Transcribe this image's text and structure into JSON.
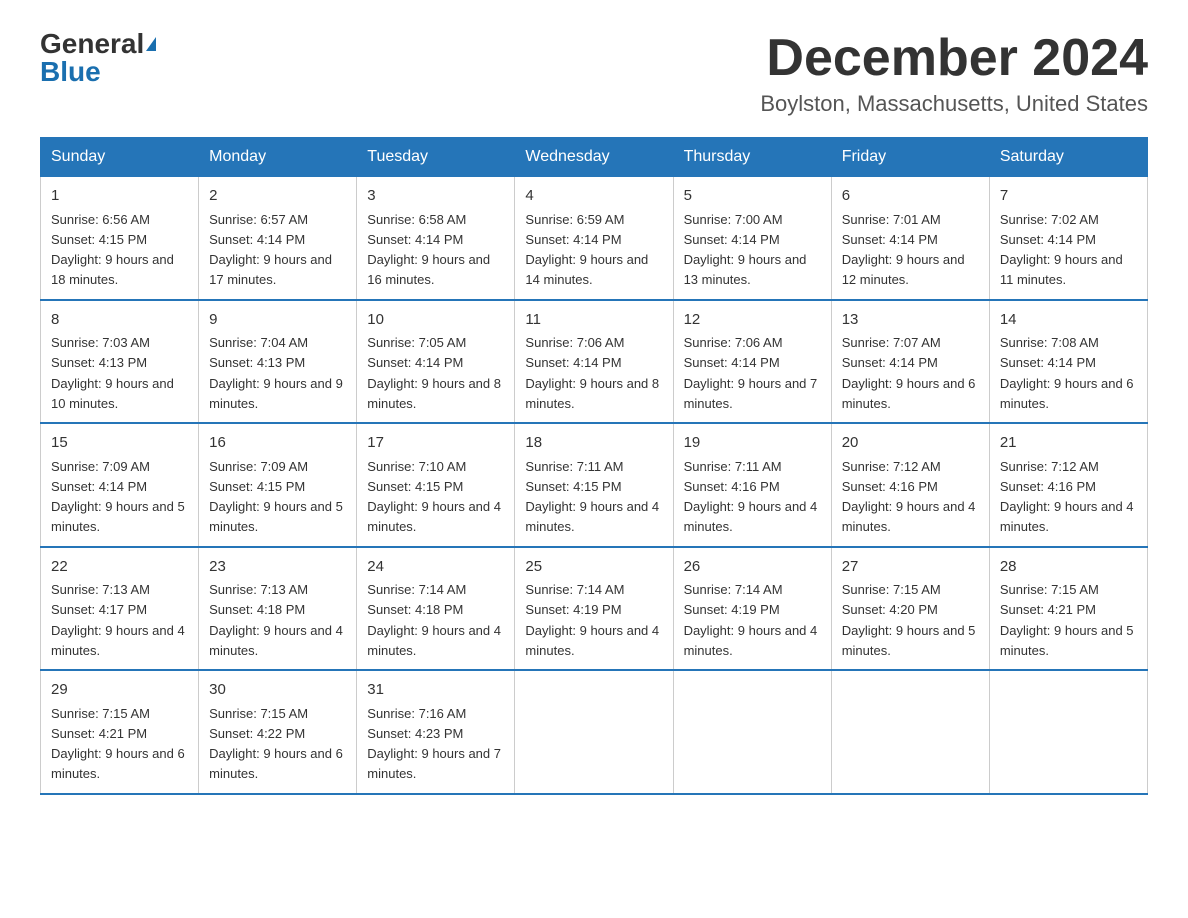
{
  "header": {
    "logo_general": "General",
    "logo_blue": "Blue",
    "title": "December 2024",
    "subtitle": "Boylston, Massachusetts, United States"
  },
  "weekdays": [
    "Sunday",
    "Monday",
    "Tuesday",
    "Wednesday",
    "Thursday",
    "Friday",
    "Saturday"
  ],
  "weeks": [
    [
      {
        "day": "1",
        "sunrise": "6:56 AM",
        "sunset": "4:15 PM",
        "daylight": "9 hours and 18 minutes."
      },
      {
        "day": "2",
        "sunrise": "6:57 AM",
        "sunset": "4:14 PM",
        "daylight": "9 hours and 17 minutes."
      },
      {
        "day": "3",
        "sunrise": "6:58 AM",
        "sunset": "4:14 PM",
        "daylight": "9 hours and 16 minutes."
      },
      {
        "day": "4",
        "sunrise": "6:59 AM",
        "sunset": "4:14 PM",
        "daylight": "9 hours and 14 minutes."
      },
      {
        "day": "5",
        "sunrise": "7:00 AM",
        "sunset": "4:14 PM",
        "daylight": "9 hours and 13 minutes."
      },
      {
        "day": "6",
        "sunrise": "7:01 AM",
        "sunset": "4:14 PM",
        "daylight": "9 hours and 12 minutes."
      },
      {
        "day": "7",
        "sunrise": "7:02 AM",
        "sunset": "4:14 PM",
        "daylight": "9 hours and 11 minutes."
      }
    ],
    [
      {
        "day": "8",
        "sunrise": "7:03 AM",
        "sunset": "4:13 PM",
        "daylight": "9 hours and 10 minutes."
      },
      {
        "day": "9",
        "sunrise": "7:04 AM",
        "sunset": "4:13 PM",
        "daylight": "9 hours and 9 minutes."
      },
      {
        "day": "10",
        "sunrise": "7:05 AM",
        "sunset": "4:14 PM",
        "daylight": "9 hours and 8 minutes."
      },
      {
        "day": "11",
        "sunrise": "7:06 AM",
        "sunset": "4:14 PM",
        "daylight": "9 hours and 8 minutes."
      },
      {
        "day": "12",
        "sunrise": "7:06 AM",
        "sunset": "4:14 PM",
        "daylight": "9 hours and 7 minutes."
      },
      {
        "day": "13",
        "sunrise": "7:07 AM",
        "sunset": "4:14 PM",
        "daylight": "9 hours and 6 minutes."
      },
      {
        "day": "14",
        "sunrise": "7:08 AM",
        "sunset": "4:14 PM",
        "daylight": "9 hours and 6 minutes."
      }
    ],
    [
      {
        "day": "15",
        "sunrise": "7:09 AM",
        "sunset": "4:14 PM",
        "daylight": "9 hours and 5 minutes."
      },
      {
        "day": "16",
        "sunrise": "7:09 AM",
        "sunset": "4:15 PM",
        "daylight": "9 hours and 5 minutes."
      },
      {
        "day": "17",
        "sunrise": "7:10 AM",
        "sunset": "4:15 PM",
        "daylight": "9 hours and 4 minutes."
      },
      {
        "day": "18",
        "sunrise": "7:11 AM",
        "sunset": "4:15 PM",
        "daylight": "9 hours and 4 minutes."
      },
      {
        "day": "19",
        "sunrise": "7:11 AM",
        "sunset": "4:16 PM",
        "daylight": "9 hours and 4 minutes."
      },
      {
        "day": "20",
        "sunrise": "7:12 AM",
        "sunset": "4:16 PM",
        "daylight": "9 hours and 4 minutes."
      },
      {
        "day": "21",
        "sunrise": "7:12 AM",
        "sunset": "4:16 PM",
        "daylight": "9 hours and 4 minutes."
      }
    ],
    [
      {
        "day": "22",
        "sunrise": "7:13 AM",
        "sunset": "4:17 PM",
        "daylight": "9 hours and 4 minutes."
      },
      {
        "day": "23",
        "sunrise": "7:13 AM",
        "sunset": "4:18 PM",
        "daylight": "9 hours and 4 minutes."
      },
      {
        "day": "24",
        "sunrise": "7:14 AM",
        "sunset": "4:18 PM",
        "daylight": "9 hours and 4 minutes."
      },
      {
        "day": "25",
        "sunrise": "7:14 AM",
        "sunset": "4:19 PM",
        "daylight": "9 hours and 4 minutes."
      },
      {
        "day": "26",
        "sunrise": "7:14 AM",
        "sunset": "4:19 PM",
        "daylight": "9 hours and 4 minutes."
      },
      {
        "day": "27",
        "sunrise": "7:15 AM",
        "sunset": "4:20 PM",
        "daylight": "9 hours and 5 minutes."
      },
      {
        "day": "28",
        "sunrise": "7:15 AM",
        "sunset": "4:21 PM",
        "daylight": "9 hours and 5 minutes."
      }
    ],
    [
      {
        "day": "29",
        "sunrise": "7:15 AM",
        "sunset": "4:21 PM",
        "daylight": "9 hours and 6 minutes."
      },
      {
        "day": "30",
        "sunrise": "7:15 AM",
        "sunset": "4:22 PM",
        "daylight": "9 hours and 6 minutes."
      },
      {
        "day": "31",
        "sunrise": "7:16 AM",
        "sunset": "4:23 PM",
        "daylight": "9 hours and 7 minutes."
      },
      null,
      null,
      null,
      null
    ]
  ]
}
